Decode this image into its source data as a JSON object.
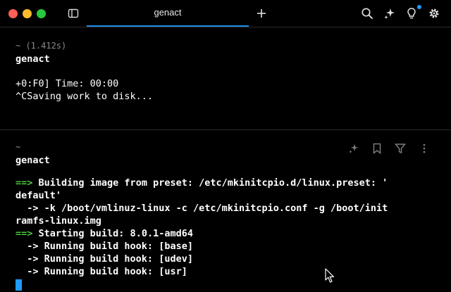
{
  "titlebar": {
    "tab_title": "genact",
    "new_tab_icon": "plus-icon",
    "icons": [
      "search-icon",
      "sparkle-icon",
      "lightbulb-icon",
      "gear-icon",
      "sidebar-icon"
    ],
    "colors": {
      "accent": "#1e8ee8",
      "notification": "#1e9bff"
    }
  },
  "block1": {
    "meta": "~ (1.412s)",
    "command": "genact",
    "lines": [
      "+0:F0] Time: 00:00",
      "^CSaving work to disk..."
    ],
    "cut_line": "                                                                   "
  },
  "block2": {
    "meta": "~",
    "command": "genact",
    "action_icons": [
      "sparkle-icon",
      "bookmark-icon",
      "filter-icon",
      "more-icon"
    ],
    "lines": [
      {
        "prefix": "==>",
        "text": " Building image from preset: /etc/mkinitcpio.d/linux.preset: '"
      },
      {
        "prefix": "",
        "text": "default'"
      },
      {
        "prefix": "",
        "text": "  -> -k /boot/vmlinuz-linux -c /etc/mkinitcpio.conf -g /boot/init"
      },
      {
        "prefix": "",
        "text": "ramfs-linux.img"
      },
      {
        "prefix": "==>",
        "text": " Starting build: 8.0.1-amd64"
      },
      {
        "prefix": "",
        "text": "  -> Running build hook: [base]"
      },
      {
        "prefix": "",
        "text": "  -> Running build hook: [udev]"
      },
      {
        "prefix": "",
        "text": "  -> Running build hook: [usr]"
      }
    ]
  }
}
